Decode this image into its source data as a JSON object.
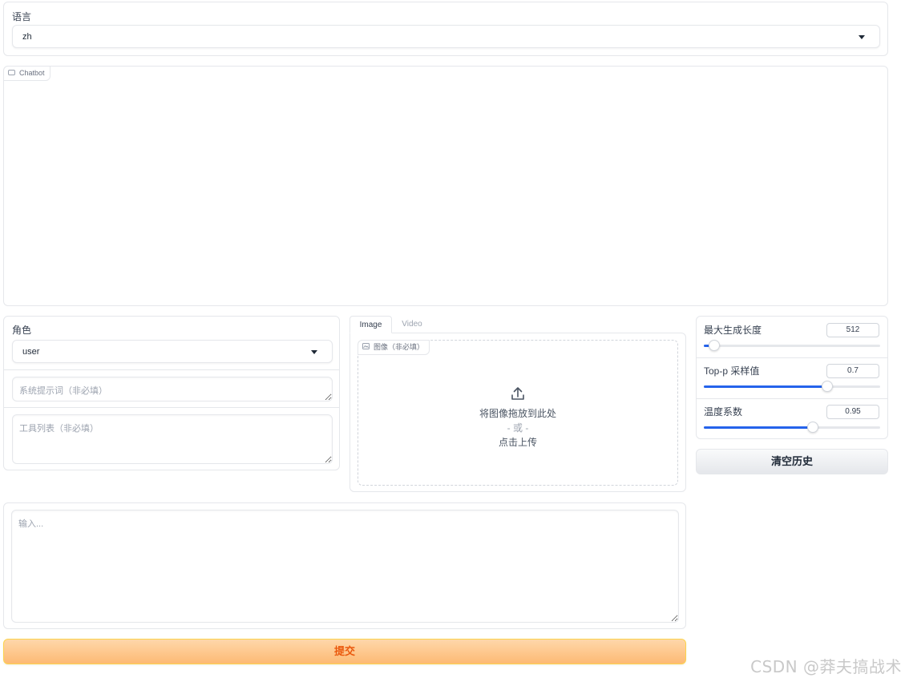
{
  "language": {
    "label": "语言",
    "value": "zh"
  },
  "chatbot": {
    "badge": "Chatbot"
  },
  "role": {
    "label": "角色",
    "value": "user",
    "system_prompt_placeholder": "系统提示词（非必填）",
    "tools_placeholder": "工具列表（非必填）"
  },
  "media": {
    "tabs": [
      "Image",
      "Video"
    ],
    "active_tab": "Image",
    "image_badge": "图像（非必填）",
    "drop_text": "将图像拖放到此处",
    "or_text": "- 或 -",
    "click_text": "点击上传"
  },
  "params": {
    "max_length": {
      "label": "最大生成长度",
      "value": "512",
      "fraction": 0.06
    },
    "top_p": {
      "label": "Top-p 采样值",
      "value": "0.7",
      "fraction": 0.7
    },
    "temperature": {
      "label": "温度系数",
      "value": "0.95",
      "fraction": 0.62
    }
  },
  "clear_button": "清空历史",
  "input": {
    "placeholder": "输入..."
  },
  "submit_button": "提交",
  "watermark": "CSDN @莽夫搞战术",
  "colors": {
    "accent": "#2563eb",
    "submit_text": "#ea580c",
    "submit_bg": "#fdba74"
  }
}
